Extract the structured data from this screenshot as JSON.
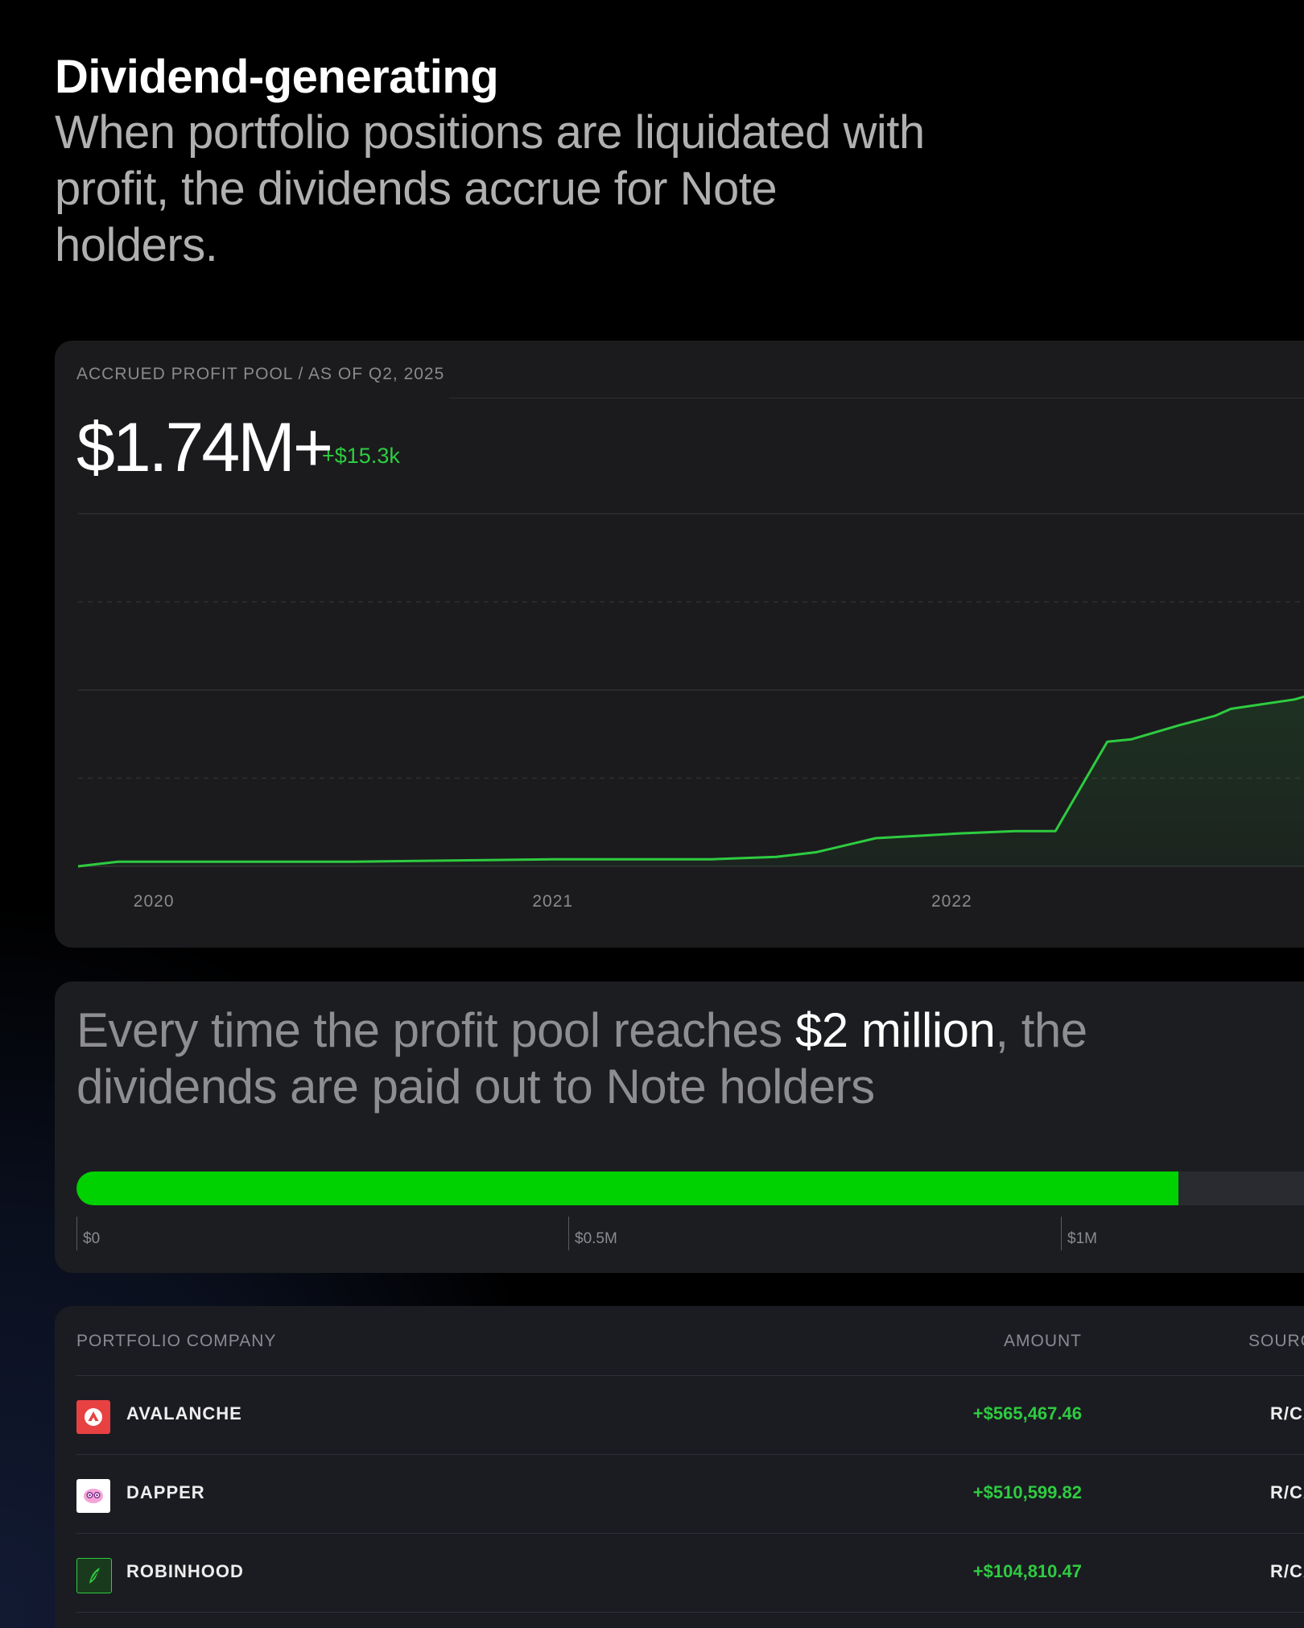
{
  "hero": {
    "title": "Dividend-generating",
    "subtitle": "When portfolio positions are liquidated with profit, the dividends accrue for Note holders."
  },
  "pool": {
    "kicker": "ACCRUED PROFIT POOL / AS OF Q2, 2025",
    "value": "$1.74M+",
    "delta": "+$15.3k"
  },
  "chart_data": {
    "type": "area",
    "x_ticks": [
      "2020",
      "2021",
      "2022"
    ],
    "xlim": [
      2019.81,
      2022.98
    ],
    "ylim": [
      0,
      1.5
    ],
    "y_unit": "$M",
    "grid": true,
    "color": "#2ecc40",
    "x": [
      2019.81,
      2019.91,
      2020.5,
      2021.0,
      2021.4,
      2021.56,
      2021.66,
      2021.81,
      2021.92,
      2022.02,
      2022.16,
      2022.26,
      2022.39,
      2022.45,
      2022.57,
      2022.66,
      2022.7,
      2022.86,
      2022.98
    ],
    "y": [
      0.0,
      0.02,
      0.02,
      0.03,
      0.03,
      0.04,
      0.06,
      0.12,
      0.13,
      0.14,
      0.15,
      0.15,
      0.53,
      0.54,
      0.6,
      0.64,
      0.67,
      0.71,
      0.77
    ]
  },
  "meter": {
    "text_prefix": "Every time the profit pool reaches ",
    "text_highlight": "$2 million",
    "text_suffix": ", the dividends are paid out to Note holders",
    "progress_fraction": 0.87,
    "fill_color": "#00d100",
    "ticks": [
      "$0",
      "$0.5M",
      "$1M"
    ]
  },
  "table": {
    "headers": {
      "company": "PORTFOLIO COMPANY",
      "amount": "AMOUNT",
      "source": "SOURC"
    },
    "rows": [
      {
        "company": "AVALANCHE",
        "amount": "+$565,467.46",
        "source": "R/CAP",
        "logo_color": "#e84142",
        "icon": "avalanche-logo-icon"
      },
      {
        "company": "DAPPER",
        "amount": "+$510,599.82",
        "source": "R/CAP",
        "logo_color": "#ffffff",
        "icon": "dapper-logo-icon"
      },
      {
        "company": "ROBINHOOD",
        "amount": "+$104,810.47",
        "source": "R/CAP",
        "logo_color": "#1a3a1e",
        "icon": "robinhood-logo-icon"
      }
    ]
  }
}
